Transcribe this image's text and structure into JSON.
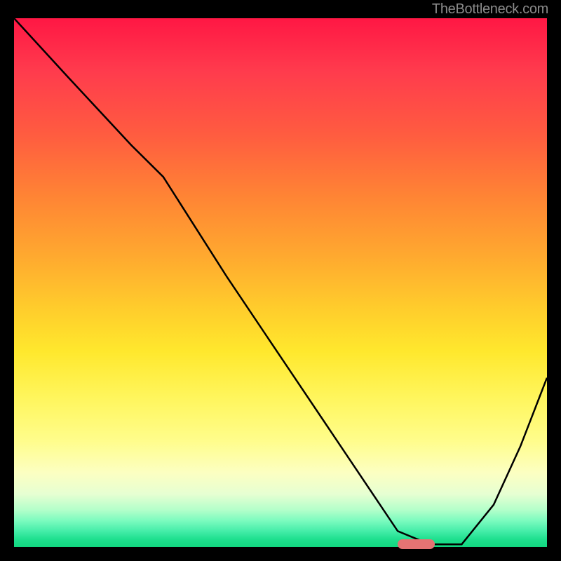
{
  "attribution": "TheBottleneck.com",
  "chart_data": {
    "type": "line",
    "title": "",
    "xlabel": "",
    "ylabel": "",
    "xlim": [
      0,
      100
    ],
    "ylim": [
      0,
      100
    ],
    "curve": {
      "x": [
        0,
        10,
        22,
        28,
        40,
        50,
        58,
        66,
        72,
        78,
        84,
        90,
        95,
        100
      ],
      "value": [
        100,
        89,
        76,
        70,
        51,
        36,
        24,
        12,
        3,
        0.5,
        0.5,
        8,
        19,
        32
      ]
    },
    "optimum_marker": {
      "x_start": 72,
      "x_end": 79,
      "value": 0.5
    },
    "gradient_stops": [
      {
        "pos": 0,
        "color": "#ff1744"
      },
      {
        "pos": 0.22,
        "color": "#ff5c40"
      },
      {
        "pos": 0.45,
        "color": "#ffa92f"
      },
      {
        "pos": 0.63,
        "color": "#ffe82d"
      },
      {
        "pos": 0.8,
        "color": "#fffd8c"
      },
      {
        "pos": 0.93,
        "color": "#b3ffca"
      },
      {
        "pos": 1.0,
        "color": "#12d780"
      }
    ]
  }
}
